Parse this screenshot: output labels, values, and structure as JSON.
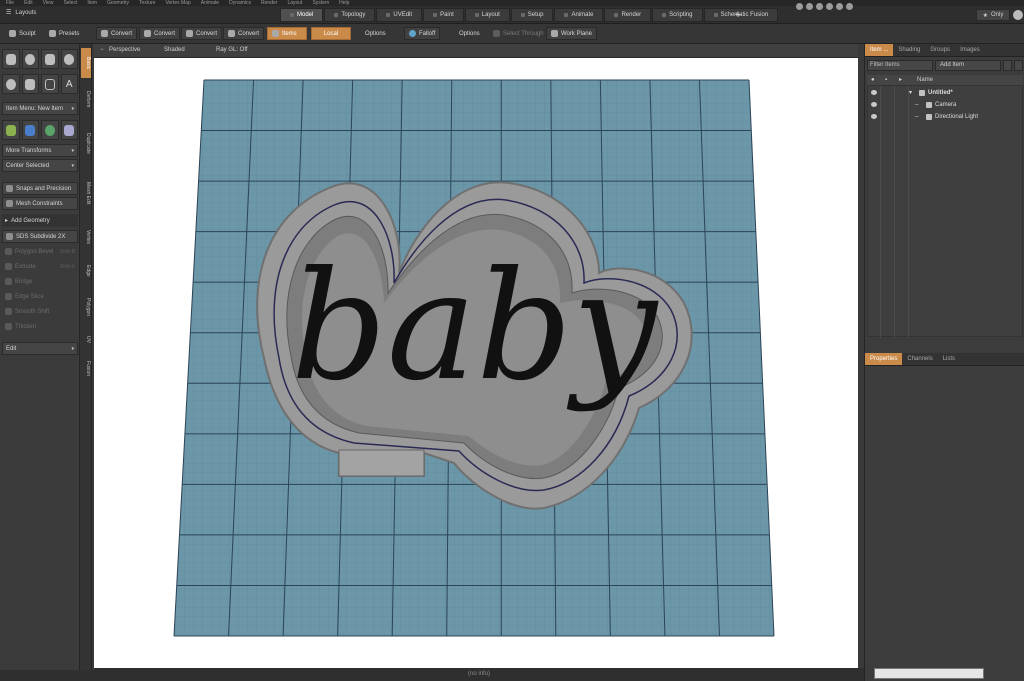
{
  "menubar": [
    "File",
    "Edit",
    "View",
    "Select",
    "Item",
    "Geometry",
    "Texture",
    "Vertex Map",
    "Animate",
    "Dynamics",
    "Render",
    "Layout",
    "System",
    "Help"
  ],
  "layouts_label": "Layouts",
  "layout_tabs": [
    "Model",
    "Topology",
    "UVEdit",
    "Paint",
    "Layout",
    "Setup",
    "Animate",
    "Render",
    "Scripting",
    "Schematic Fusion"
  ],
  "only_label": "Only",
  "toolbar": {
    "sculpt": "Sculpt",
    "presets": "Presets",
    "convert1": "Convert",
    "convert2": "Convert",
    "convert3": "Convert",
    "convert4": "Convert",
    "items": "Items",
    "local": "Local",
    "options1": "Options",
    "falloff": "Falloff",
    "options2": "Options",
    "select_through": "Select Through",
    "work_plane": "Work Plane"
  },
  "left_panel": {
    "item_menu": "Item Menu: New Item",
    "more_transforms": "More Transforms",
    "center_selected": "Center Selected",
    "snaps": "Snaps and Precision",
    "mesh_constraints": "Mesh Constraints",
    "add_geometry": "Add Geometry",
    "sds": "SDS Subdivide 2X",
    "polygon_bevel": "Polygon Bevel",
    "polygon_bevel_key": "Shift-B",
    "extrude": "Extrude",
    "extrude_key": "Shift-X",
    "bridge": "Bridge",
    "edge_slice": "Edge Slice",
    "smooth_shift": "Smooth Shift",
    "thicken": "Thicken",
    "edit": "Edit"
  },
  "side_tabs": [
    "Basic",
    "Deform",
    "Duplicate",
    "Mesh Edit",
    "Vertex",
    "Edge",
    "Polygon",
    "UV",
    "Fusion"
  ],
  "viewport": {
    "perspective": "Perspective",
    "shaded": "Shaded",
    "ray_gl": "Ray GL: Off",
    "model_text": "baby"
  },
  "right_panel": {
    "tabs": [
      "Item ...",
      "Shading",
      "Groups",
      "Images"
    ],
    "filter_items": "Filter Items",
    "add_item": "Add Item",
    "col_name": "Name",
    "tree": [
      {
        "label": "Untitled*"
      },
      {
        "label": "Camera"
      },
      {
        "label": "Directional Light"
      }
    ],
    "bottom_tabs": [
      "Properties",
      "Channels",
      "Lists"
    ]
  },
  "status": "(no info)",
  "colors": {
    "accent": "#c98a4a",
    "grid_plane": "#6b97a9",
    "cutter": "#9a9a9a"
  }
}
